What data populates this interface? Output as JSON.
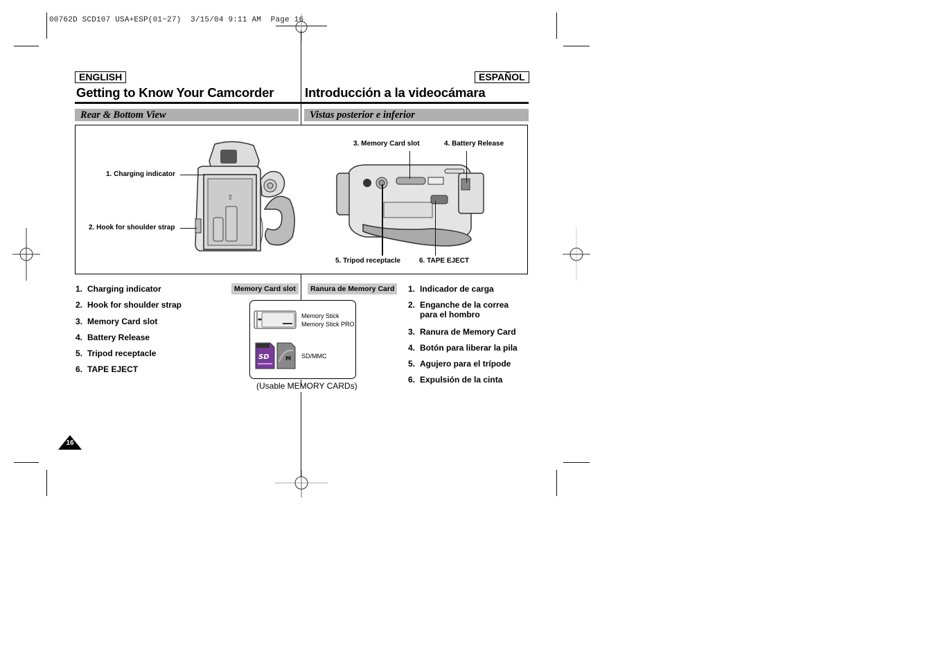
{
  "print_slug": "00762D SCD107 USA+ESP(01~27)  3/15/04 9:11 AM  Page 16",
  "english": {
    "lang_label": "ENGLISH",
    "title": "Getting to Know Your Camcorder",
    "section": "Rear & Bottom View",
    "items": [
      {
        "num": "1.",
        "text": "Charging indicator"
      },
      {
        "num": "2.",
        "text": "Hook for shoulder strap"
      },
      {
        "num": "3.",
        "text": "Memory Card slot"
      },
      {
        "num": "4.",
        "text": "Battery Release"
      },
      {
        "num": "5.",
        "text": "Tripod receptacle"
      },
      {
        "num": "6.",
        "text": "TAPE EJECT"
      }
    ],
    "memory_label": "Memory Card slot"
  },
  "spanish": {
    "lang_label": "ESPAÑOL",
    "title": "Introducción a la videocámara",
    "section": "Vistas posterior e inferior",
    "items": [
      {
        "num": "1.",
        "text": "Indicador de carga"
      },
      {
        "num": "2.",
        "text": "Enganche de la correa para el hombro"
      },
      {
        "num": "3.",
        "text": "Ranura de Memory Card"
      },
      {
        "num": "4.",
        "text": "Botón para liberar la pila"
      },
      {
        "num": "5.",
        "text": "Agujero para el trípode"
      },
      {
        "num": "6.",
        "text": "Expulsión de la cinta"
      }
    ],
    "memory_label": "Ranura de Memory Card"
  },
  "figure": {
    "callouts": {
      "charging": "1. Charging indicator",
      "hook": "2. Hook for shoulder strap",
      "memory": "3. Memory Card slot",
      "battery": "4. Battery Release",
      "tripod": "5. Tripod receptacle",
      "tape": "6. TAPE EJECT"
    }
  },
  "cards": {
    "memory_stick": "Memory Stick",
    "memory_stick_pro": "Memory Stick PRO",
    "sd_mmc": "SD/MMC",
    "caption": "(Usable MEMORY CARDs)"
  },
  "page_number": "16",
  "colors": {
    "section_bar": "#b0b0b0",
    "label_gray": "#c9c9c9",
    "sd_purple": "#7a3a9a"
  }
}
